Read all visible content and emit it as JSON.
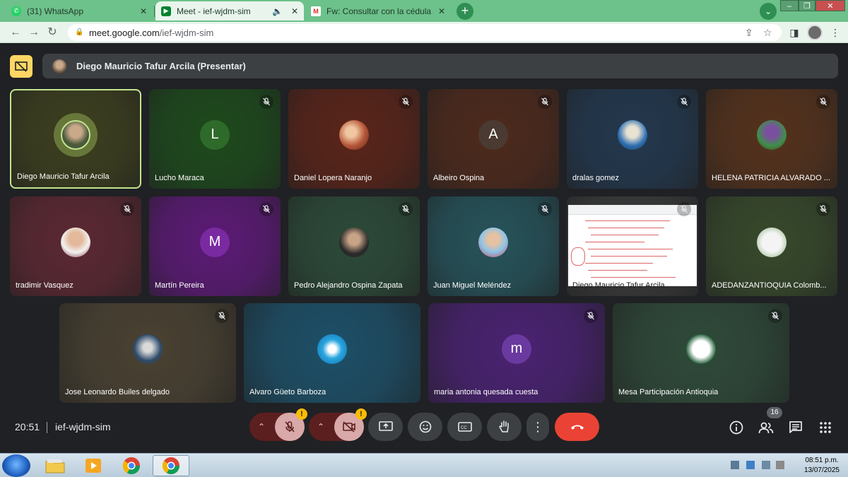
{
  "browser": {
    "tabs": [
      {
        "title": "(31) WhatsApp",
        "favicon": "whatsapp-icon",
        "active": false
      },
      {
        "title": "Meet - ief-wjdm-sim",
        "favicon": "meet-icon",
        "active": true
      },
      {
        "title": "Fw: Consultar con la cédula si soy",
        "favicon": "gmail-icon",
        "active": false
      }
    ],
    "url_host": "meet.google.com",
    "url_path": "/ief-wjdm-sim",
    "accent": "#6dc18a"
  },
  "presenter": {
    "label": "Diego Mauricio Tafur Arcila (Presentar)"
  },
  "participants": [
    {
      "name": "Diego Mauricio Tafur Arcila",
      "initial": "",
      "muted": false,
      "speaking": true,
      "bg": "#3c3f1e"
    },
    {
      "name": "Lucho Maraca",
      "initial": "L",
      "muted": true,
      "bg": "#1e4a1c"
    },
    {
      "name": "Daniel Lopera Naranjo",
      "initial": "",
      "muted": true,
      "bg": "#5a2419"
    },
    {
      "name": "Albeiro Ospina",
      "initial": "A",
      "muted": true,
      "bg": "#4e2a1c"
    },
    {
      "name": "dralas gomez",
      "initial": "",
      "muted": true,
      "bg": "#23384e"
    },
    {
      "name": "HELENA PATRICIA ALVARADO ...",
      "initial": "",
      "muted": true,
      "bg": "#55321c"
    },
    {
      "name": "tradimir Vasquez",
      "initial": "",
      "muted": true,
      "bg": "#5c2832"
    },
    {
      "name": "Martín Pereira",
      "initial": "M",
      "muted": true,
      "bg": "#5c1a76"
    },
    {
      "name": "Pedro Alejandro Ospina Zapata",
      "initial": "",
      "muted": true,
      "bg": "#2c4a38"
    },
    {
      "name": "Juan Miguel Meléndez",
      "initial": "",
      "muted": true,
      "bg": "#26535a"
    },
    {
      "name": "Diego Mauricio Tafur Arcila",
      "initial": "",
      "muted": true,
      "bg": "#3a3a3a"
    },
    {
      "name": "ADEDANZANTIOQUIA Colomb...",
      "initial": "",
      "muted": true,
      "bg": "#37492b"
    },
    {
      "name": "Jose Leonardo Builes delgado",
      "initial": "",
      "muted": true,
      "bg": "#4a4232"
    },
    {
      "name": "Alvaro Güeto Barboza",
      "initial": "",
      "muted": false,
      "bg": "#1d5068"
    },
    {
      "name": "maria antonia quesada cuesta",
      "initial": "m",
      "muted": true,
      "bg": "#4a2272"
    },
    {
      "name": "Mesa Participación Antioquia",
      "initial": "",
      "muted": true,
      "bg": "#2f4a39"
    }
  ],
  "bottom": {
    "time": "20:51",
    "meeting_code": "ief-wjdm-sim",
    "participant_count": "16",
    "warning_mark": "!"
  },
  "taskbar": {
    "time": "08:51 p.m.",
    "date": "13/07/2025"
  }
}
